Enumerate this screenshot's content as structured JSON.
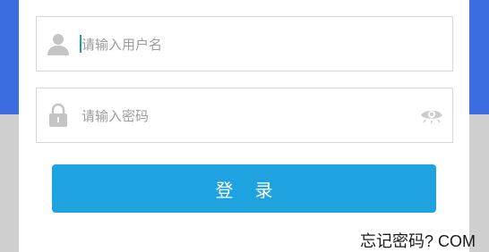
{
  "form": {
    "username_placeholder": "请输入用户名",
    "password_placeholder": "请输入密码",
    "login_label": "登录"
  },
  "icons": {
    "user": "user-icon",
    "lock": "lock-icon",
    "eye": "eye-icon"
  },
  "watermark": "忘记密码?  COM",
  "colors": {
    "header_blue": "#3b6de0",
    "button_blue": "#1ea2e0",
    "caret": "#1f9f8a"
  }
}
